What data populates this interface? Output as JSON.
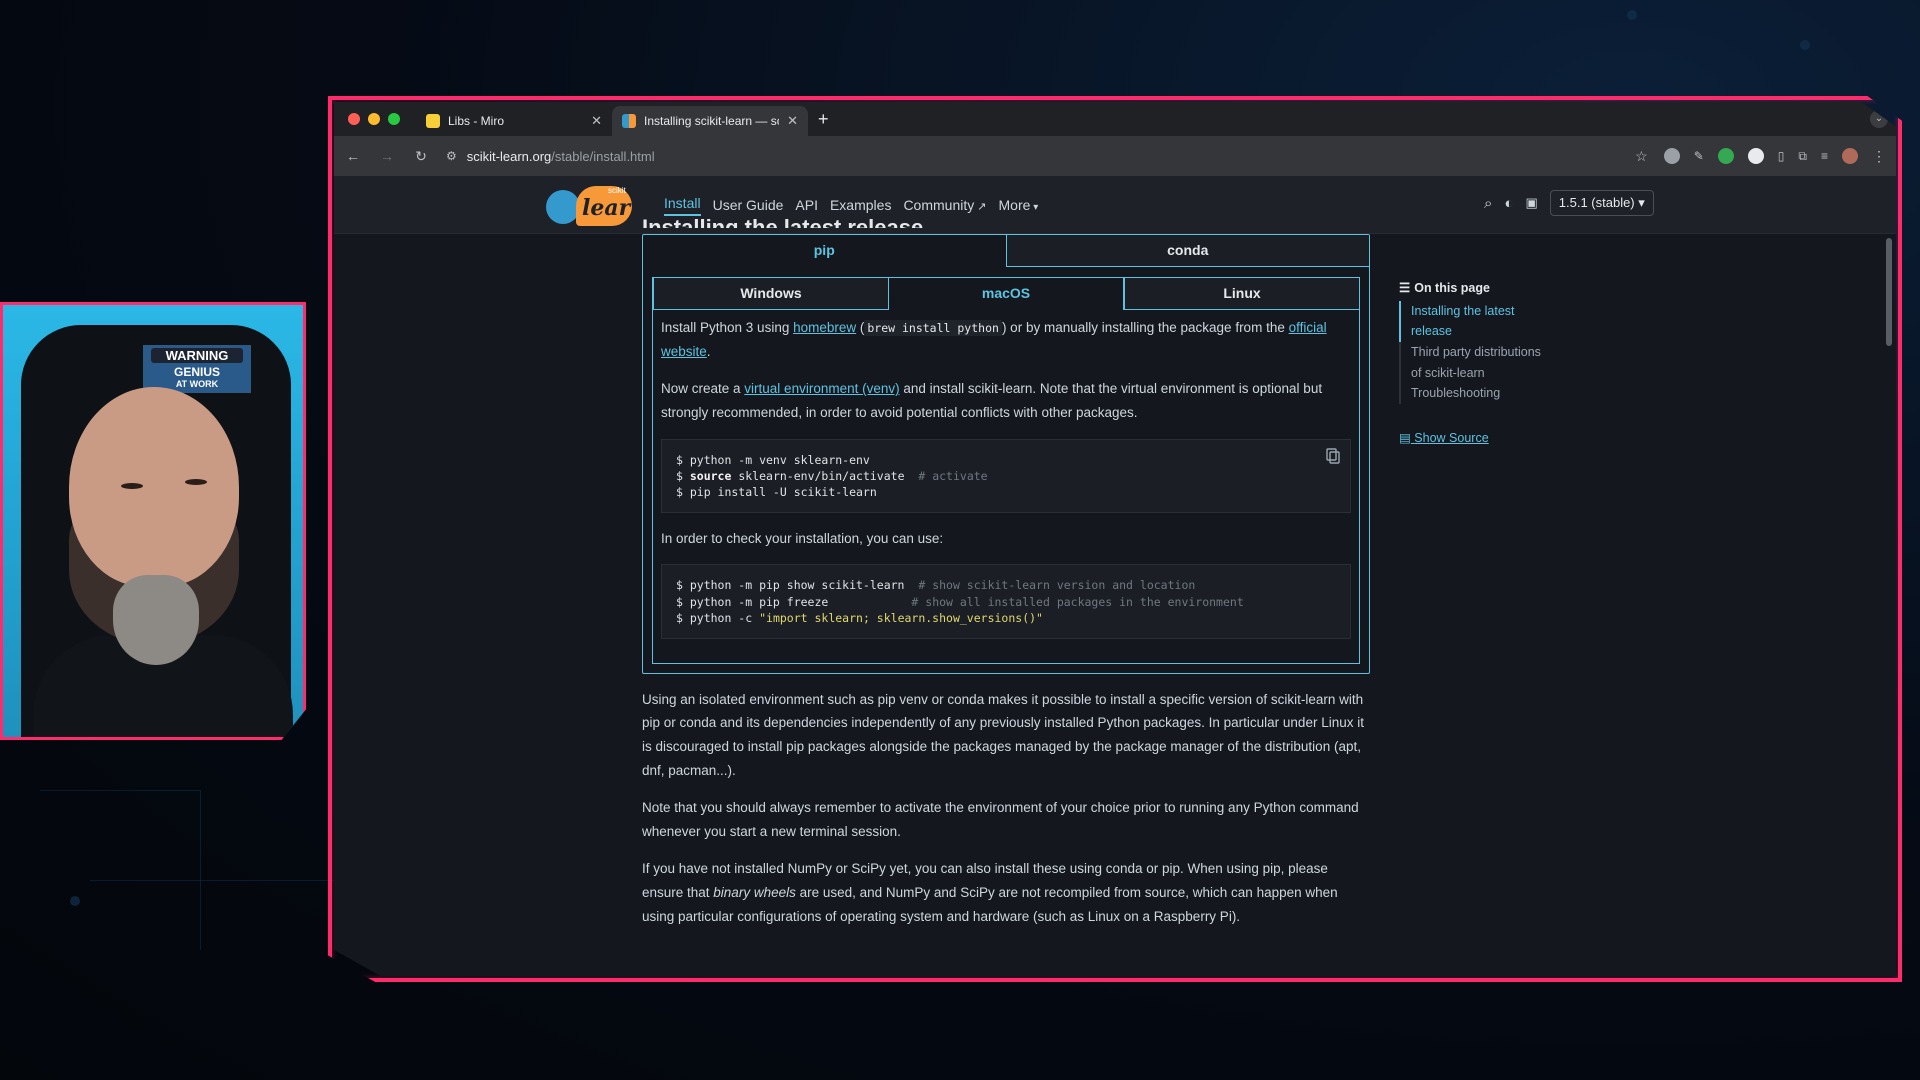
{
  "browser": {
    "tabs": [
      {
        "title": "Libs - Miro",
        "favicon_color": "#f7d039",
        "active": false
      },
      {
        "title": "Installing scikit-learn — scikit",
        "favicon_color": "#f89939",
        "active": true
      }
    ],
    "url_host": "scikit-learn.org",
    "url_path": "/stable/install.html"
  },
  "site": {
    "logo_text": "learn",
    "logo_super": "scikit",
    "nav": [
      "Install",
      "User Guide",
      "API",
      "Examples",
      "Community",
      "More"
    ],
    "version": "1.5.1 (stable)",
    "accent": "#5fc2e0"
  },
  "content": {
    "heading": "Installing the latest release",
    "outer_tabs": [
      "pip",
      "conda"
    ],
    "os_tabs": [
      "Windows",
      "macOS",
      "Linux"
    ],
    "p1_a": "Install Python 3 using ",
    "p1_link": "homebrew",
    "p1_b": " (",
    "p1_code": "brew install python",
    "p1_c": ") or by manually installing the package from the ",
    "p1_link2": "official website",
    "p1_d": ".",
    "p2_a": "Now create a ",
    "p2_link": "virtual environment (venv)",
    "p2_b": " and install scikit-learn. Note that the virtual environment is optional but strongly recommended, in order to avoid potential conflicts with other packages.",
    "code1": [
      {
        "cmd": "$ python -m venv sklearn-env",
        "comment": ""
      },
      {
        "kw": "source",
        "pre": "$ ",
        "cmd": " sklearn-env/bin/activate",
        "comment": "# activate"
      },
      {
        "cmd": "$ pip install -U scikit-learn",
        "comment": ""
      }
    ],
    "p3": "In order to check your installation, you can use:",
    "code2": [
      {
        "cmd": "$ python -m pip show scikit-learn",
        "comment": "# show scikit-learn version and location"
      },
      {
        "cmd": "$ python -m pip freeze",
        "comment": "# show all installed packages in the environment"
      },
      {
        "pre": "$ python -c ",
        "str": "\"import sklearn; sklearn.show_versions()\"",
        "comment": ""
      }
    ],
    "p4": "Using an isolated environment such as pip venv or conda makes it possible to install a specific version of scikit-learn with pip or conda and its dependencies independently of any previously installed Python packages. In particular under Linux it is discouraged to install pip packages alongside the packages managed by the package manager of the distribution (apt, dnf, pacman...).",
    "p5": "Note that you should always remember to activate the environment of your choice prior to running any Python command whenever you start a new terminal session.",
    "p6_a": "If you have not installed NumPy or SciPy yet, you can also install these using conda or pip. When using pip, please ensure that ",
    "p6_em": "binary wheels",
    "p6_b": " are used, and NumPy and SciPy are not recompiled from source, which can happen when using particular configurations of operating system and hardware (such as Linux on a Raspberry Pi)."
  },
  "toc": {
    "title": "On this page",
    "items": [
      "Installing the latest release",
      "Third party distributions of scikit-learn",
      "Troubleshooting"
    ],
    "show_source": "Show Source"
  },
  "webcam": {
    "poster_line1": "WARNING",
    "poster_line2": "GENIUS",
    "poster_line3": "AT WORK"
  }
}
